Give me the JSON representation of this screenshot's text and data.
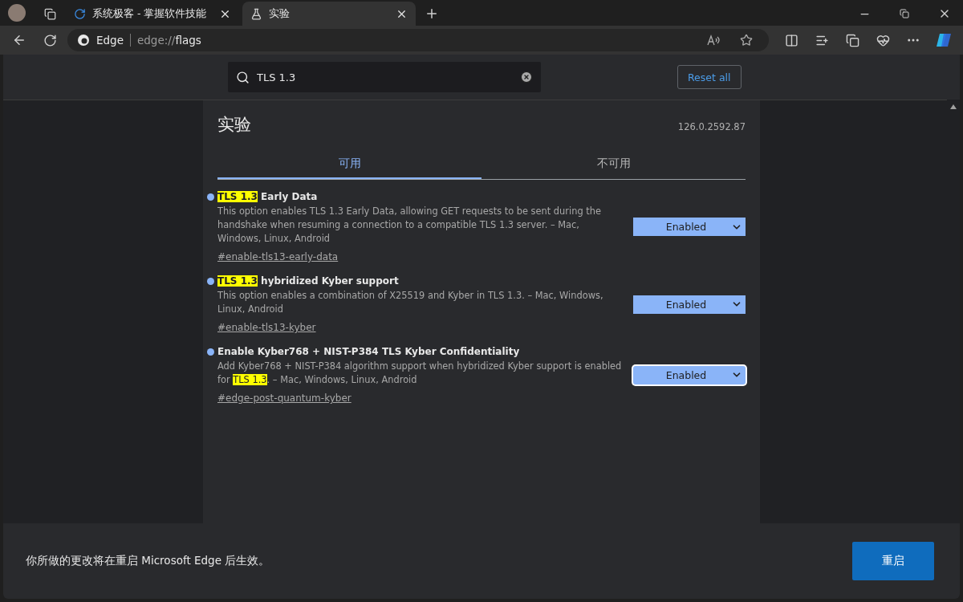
{
  "tabs": [
    {
      "kind": "site",
      "title": "系统极客 - 掌握软件技能",
      "selected": false
    },
    {
      "kind": "flask",
      "title": "实验",
      "selected": true
    }
  ],
  "address": {
    "label": "Edge",
    "scheme": "edge://",
    "path": "flags"
  },
  "search": {
    "value": "TLS 1.3"
  },
  "reset_button": "Reset all",
  "page": {
    "title": "实验",
    "version": "126.0.2592.87"
  },
  "flag_tabs": [
    {
      "label": "可用",
      "selected": true
    },
    {
      "label": "不可用",
      "selected": false
    }
  ],
  "flags": [
    {
      "title": [
        {
          "text": "TLS 1.3",
          "highlighted": true
        },
        {
          "text": " Early Data",
          "highlighted": false
        }
      ],
      "description": [
        {
          "text": "This option enables TLS 1.3 Early Data, allowing GET requests to be sent during the handshake when resuming a connection to a compatible TLS 1.3 server. – Mac, Windows, Linux, Android",
          "highlighted": false
        }
      ],
      "link": "#enable-tls13-early-data",
      "value": "Enabled",
      "focused": false
    },
    {
      "title": [
        {
          "text": "TLS 1.3",
          "highlighted": true
        },
        {
          "text": " hybridized Kyber support",
          "highlighted": false
        }
      ],
      "description": [
        {
          "text": "This option enables a combination of X25519 and Kyber in TLS 1.3. – Mac, Windows, Linux, Android",
          "highlighted": false
        }
      ],
      "link": "#enable-tls13-kyber",
      "value": "Enabled",
      "focused": false
    },
    {
      "title": [
        {
          "text": "Enable Kyber768 + NIST-P384 TLS Kyber Confidentiality",
          "highlighted": false
        }
      ],
      "description": [
        {
          "text": "Add Kyber768 + NIST-P384 algorithm support when hybridized Kyber support is enabled for ",
          "highlighted": false
        },
        {
          "text": "TLS 1.3",
          "highlighted": true
        },
        {
          "text": ". – Mac, Windows, Linux, Android",
          "highlighted": false
        }
      ],
      "link": "#edge-post-quantum-kyber",
      "value": "Enabled",
      "focused": true
    }
  ],
  "restart_bar": {
    "message": "你所做的更改将在重启 Microsoft Edge 后生效。",
    "button": "重启"
  }
}
